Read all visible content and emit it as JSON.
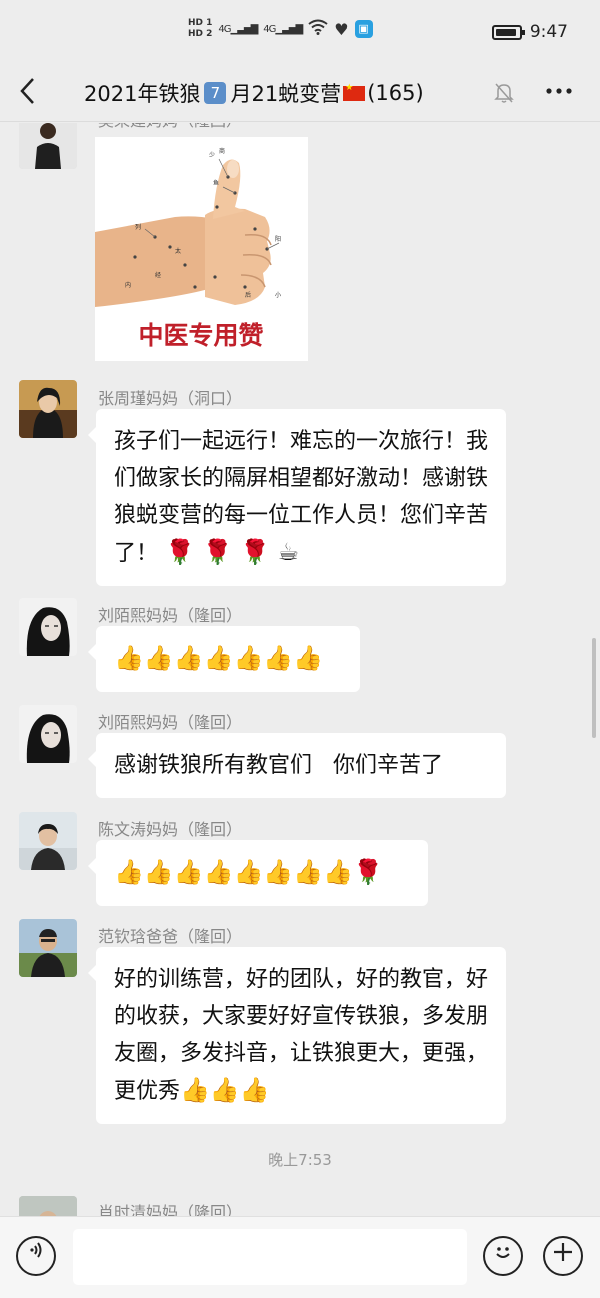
{
  "status_bar": {
    "hd1": "HD 1",
    "hd2": "HD 2",
    "net1": "4G",
    "net2": "4G",
    "time": "9:47"
  },
  "header": {
    "title_prefix": "2021年铁狼",
    "title_badge": "7",
    "title_middle": "月21蜕变营",
    "title_count": "(165)"
  },
  "messages": [
    {
      "name": "吴荣建妈妈（隆回）",
      "type": "image",
      "image_caption": "中医专用赞"
    },
    {
      "name": "张周瑾妈妈（洞口）",
      "text": "孩子们一起远行！难忘的一次旅行！我们做家长的隔屏相望都好激动！感谢铁狼蜕变营的每一位工作人员！您们辛苦了！",
      "emoji": "🌹 🌹 🌹 ☕"
    },
    {
      "name": "刘陌熙妈妈（隆回）",
      "emoji": "👍👍👍👍👍👍👍"
    },
    {
      "name": "刘陌熙妈妈（隆回）",
      "text": "感谢铁狼所有教官们   你们辛苦了"
    },
    {
      "name": "陈文涛妈妈（隆回）",
      "emoji": "👍👍👍👍👍👍👍👍🌹"
    },
    {
      "name": "范钦琀爸爸（隆回）",
      "text": "好的训练营，好的团队，好的教官，好的收获，大家要好好宣传铁狼，多发朋友圈，多发抖音，让铁狼更大，更强，更优秀",
      "emoji": "👍👍👍"
    },
    {
      "name": "肖时清妈妈（隆回）"
    }
  ],
  "time_divider": "晚上7:53",
  "colors": {
    "background": "#ededed",
    "bubble": "#ffffff",
    "name_text": "#888888",
    "red_title": "#c0202a"
  },
  "icons": {
    "back": "chevron-left-icon",
    "mute": "bell-off-icon",
    "more": "more-icon",
    "voice": "voice-icon",
    "emoji": "emoji-icon",
    "plus": "plus-icon"
  }
}
